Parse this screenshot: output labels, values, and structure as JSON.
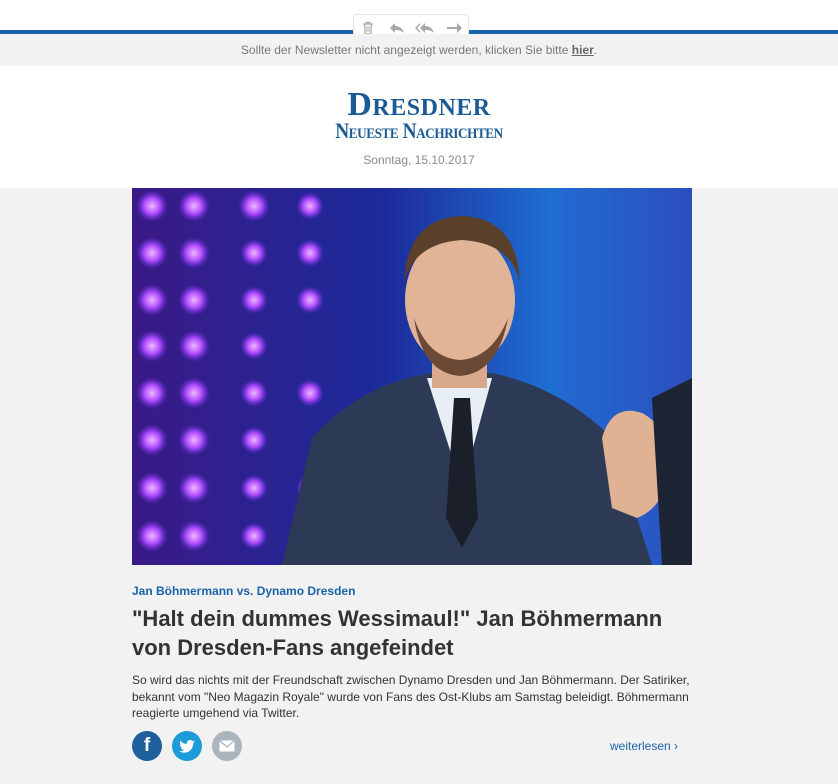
{
  "toolbar": {
    "icons": [
      "trash-icon",
      "reply-icon",
      "reply-all-icon",
      "forward-icon"
    ]
  },
  "notice": {
    "text": "Sollte der Newsletter nicht angezeigt werden, klicken Sie bitte ",
    "link_label": "hier",
    "suffix": "."
  },
  "header": {
    "logo_line1": "Dresdner",
    "logo_line2": "Neueste Nachrichten",
    "date": "Sonntag, 15.10.2017"
  },
  "article": {
    "kicker": "Jan Böhmermann vs. Dynamo Dresden",
    "headline": "\"Halt dein dummes Wessimaul!\" Jan Böhmermann von Dresden-Fans angefeindet",
    "teaser": "So wird das nichts mit der Freundschaft zwischen Dynamo Dresden und Jan Böhmermann. Der Satiriker, bekannt vom \"Neo Magazin Royale\" wurde von Fans des Ost-Klubs am Samstag beleidigt. Böhmermann reagierte umgehend via Twitter.",
    "read_more": "weiterlesen ›"
  },
  "social": {
    "facebook_color": "#1f5f9c",
    "twitter_color": "#1d9ad8",
    "mail_color": "#a9b4bd"
  },
  "colors": {
    "accent": "#1b63a8",
    "logo": "#1b5b95"
  }
}
